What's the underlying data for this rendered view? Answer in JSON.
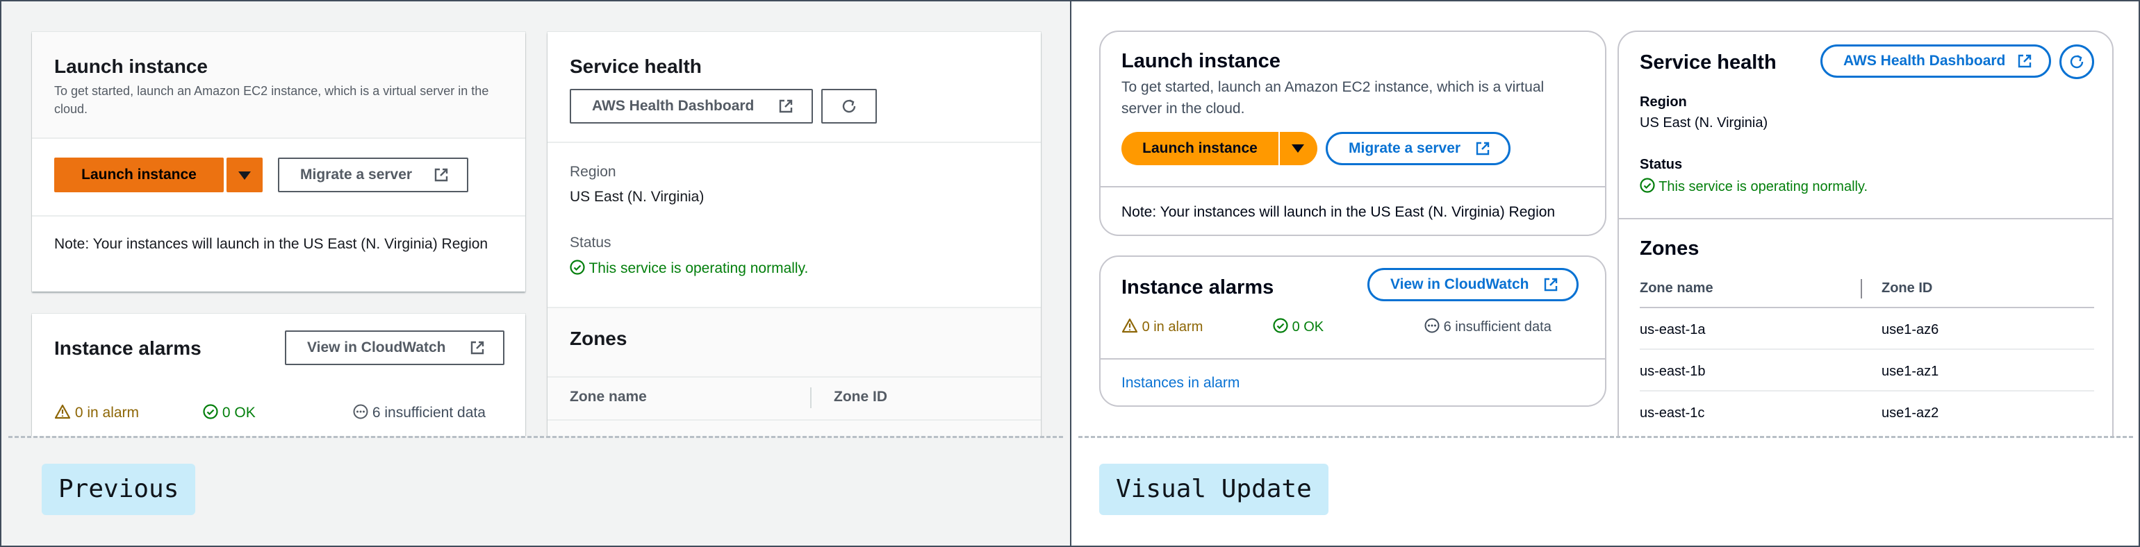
{
  "captions": {
    "previous": "Previous",
    "visual_update": "Visual Update"
  },
  "launch": {
    "title": "Launch instance",
    "description_prev": "To get started, launch an Amazon EC2 instance, which is a virtual server in the cloud.",
    "description_new": "To get started, launch an Amazon EC2 instance, which is a virtual server in the cloud.",
    "launch_button": "Launch instance",
    "migrate_button": "Migrate a server",
    "note": "Note: Your instances will launch in the US East (N. Virginia) Region"
  },
  "alarms": {
    "title": "Instance alarms",
    "cloudwatch_button": "View in CloudWatch",
    "in_alarm": "0 in alarm",
    "ok": "0 OK",
    "insufficient": "6 insufficient data",
    "link": "Instances in alarm"
  },
  "health": {
    "title": "Service health",
    "dashboard_button": "AWS Health Dashboard",
    "region_label": "Region",
    "region_value": "US East (N. Virginia)",
    "status_label": "Status",
    "status_value": "This service is operating normally."
  },
  "zones": {
    "title": "Zones",
    "col_name": "Zone name",
    "col_id": "Zone ID",
    "rows": [
      {
        "name": "us-east-1a",
        "id": "use1-az6"
      },
      {
        "name": "us-east-1b",
        "id": "use1-az1"
      },
      {
        "name": "us-east-1c",
        "id": "use1-az2"
      }
    ]
  },
  "colors": {
    "classic_primary": "#ec7211",
    "refresh_primary": "#ff9900",
    "link_blue": "#0972d3",
    "success_green": "#037f0c",
    "warning_amber": "#8d6605",
    "caption_bg": "#c9ecfa"
  },
  "icons": [
    "external-link-icon",
    "refresh-icon",
    "caret-down-icon",
    "warning-icon",
    "check-circle-icon",
    "ellipsis-circle-icon"
  ]
}
